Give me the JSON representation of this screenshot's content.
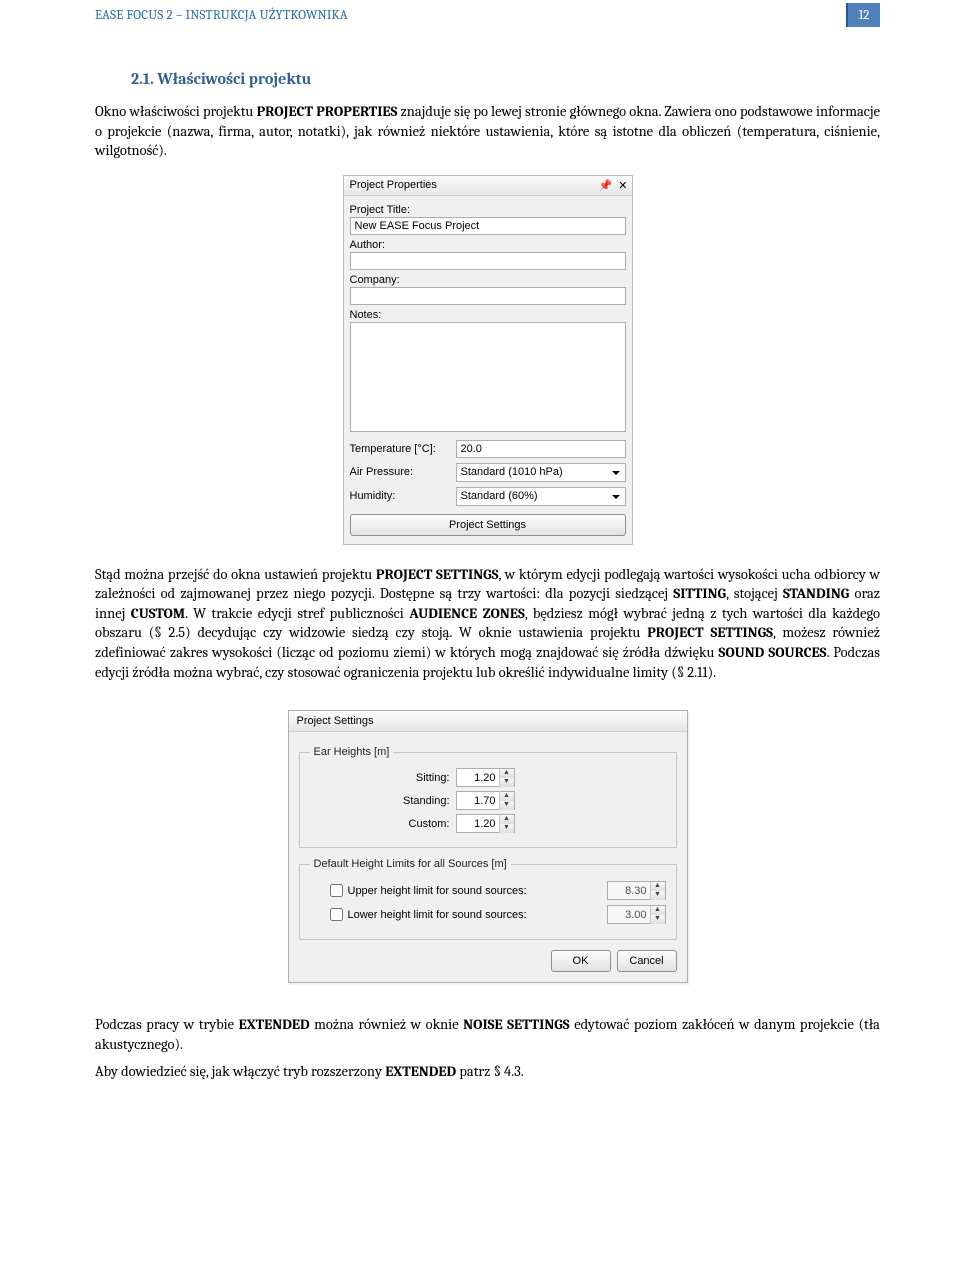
{
  "header": {
    "title": "EASE FOCUS 2 – INSTRUKCJA UŻYTKOWNIKA",
    "page_number": "12"
  },
  "section_heading": "2.1.    Właściwości projektu",
  "para1_parts": {
    "p1a": "Okno właściwości projektu ",
    "p1b": "PROJECT PROPERTIES",
    "p1c": " znajduje się po lewej stronie głównego okna. Zawiera ono podstawowe informacje o projekcie (nazwa, firma, autor, notatki), jak również niektóre ustawienia, które są istotne dla obliczeń (temperatura, ciśnienie, wilgotność)."
  },
  "panel": {
    "title": "Project Properties",
    "lbl_title": "Project Title:",
    "val_title": "New EASE Focus Project",
    "lbl_author": "Author:",
    "val_author": "",
    "lbl_company": "Company:",
    "val_company": "",
    "lbl_notes": "Notes:",
    "val_notes": "",
    "lbl_temp": "Temperature [°C]:",
    "val_temp": "20.0",
    "lbl_pressure": "Air Pressure:",
    "val_pressure": "Standard (1010 hPa)",
    "lbl_humidity": "Humidity:",
    "val_humidity": "Standard (60%)",
    "btn_settings": "Project Settings"
  },
  "para2_parts": {
    "a": "Stąd można przejść do okna ustawień projektu  ",
    "b": "PROJECT SETTINGS",
    "c": ", w którym edycji podlegają wartości wysokości ucha odbiorcy w zależności od zajmowanej przez niego pozycji. Dostępne są trzy wartości: dla pozycji siedzącej ",
    "d": "SITTING",
    "e": ", stojącej ",
    "f": "STANDING",
    "g": " oraz innej ",
    "h": "CUSTOM",
    "i": ". W trakcie edycji stref publiczności ",
    "j": "AUDIENCE ZONES",
    "k": ", będziesz mógł wybrać jedną z tych wartości dla każdego obszaru (§ 2.5) decydując czy widzowie siedzą czy stoją. W oknie ustawienia projektu ",
    "l": "PROJECT SETTINGS",
    "m": ", możesz również zdefiniować zakres wysokości (licząc od poziomu ziemi) w których mogą znajdować się źródła dźwięku ",
    "n": "SOUND SOURCES",
    "o": ". Podczas edycji źródła można wybrać, czy stosować ograniczenia projektu lub określić indywidualne limity (§ 2.11)."
  },
  "dialog": {
    "title": "Project Settings",
    "fieldset1_legend": "Ear Heights [m]",
    "ear_sitting_lbl": "Sitting:",
    "ear_sitting_val": "1.20",
    "ear_standing_lbl": "Standing:",
    "ear_standing_val": "1.70",
    "ear_custom_lbl": "Custom:",
    "ear_custom_val": "1.20",
    "fieldset2_legend": "Default Height Limits for all Sources [m]",
    "upper_lbl": "Upper height limit for sound sources:",
    "upper_val": "8.30",
    "lower_lbl": "Lower height limit for sound sources:",
    "lower_val": "3.00",
    "btn_ok": "OK",
    "btn_cancel": "Cancel"
  },
  "para3_parts": {
    "a": "Podczas pracy w trybie ",
    "b": "EXTENDED",
    "c": " można również w oknie ",
    "d": "NOISE SETTINGS",
    "e": " edytować poziom zakłóceń w danym projekcie (tła akustycznego)."
  },
  "para4_parts": {
    "a": "Aby dowiedzieć się, jak włączyć tryb rozszerzony ",
    "b": "EXTENDED",
    "c": " patrz § 4.3."
  }
}
